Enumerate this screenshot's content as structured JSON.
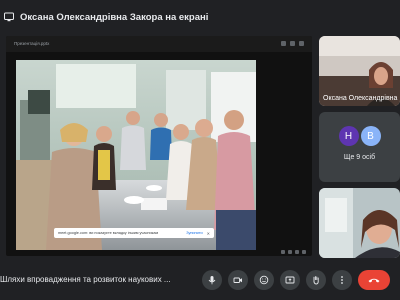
{
  "topbar": {
    "title": "Оксана Олександрівна Закора на екрані"
  },
  "stage": {
    "file_name": "Презентація.pptx",
    "notification": {
      "text": "meet.google.com: ви показуєте вкладку іншим учасникам",
      "stop_label": "Зупинити",
      "close_label": "✕"
    }
  },
  "tiles": [
    {
      "name": "Оксана Олександрівна"
    },
    {
      "avatars": [
        "Н",
        "В"
      ],
      "more": "Ще 9 осіб"
    },
    {
      "name": ""
    }
  ],
  "bottombar": {
    "meeting_title": "Шляхи впровадження та розвиток наукових ..."
  },
  "controls": [
    "microphone",
    "camera",
    "captions",
    "present",
    "raise-hand",
    "more",
    "end-call"
  ],
  "colors": {
    "background": "#202124",
    "tile": "#3c4043",
    "end_call": "#ea4335",
    "avatar_n": "#5e35b1",
    "avatar_v": "#8ab4f8"
  }
}
